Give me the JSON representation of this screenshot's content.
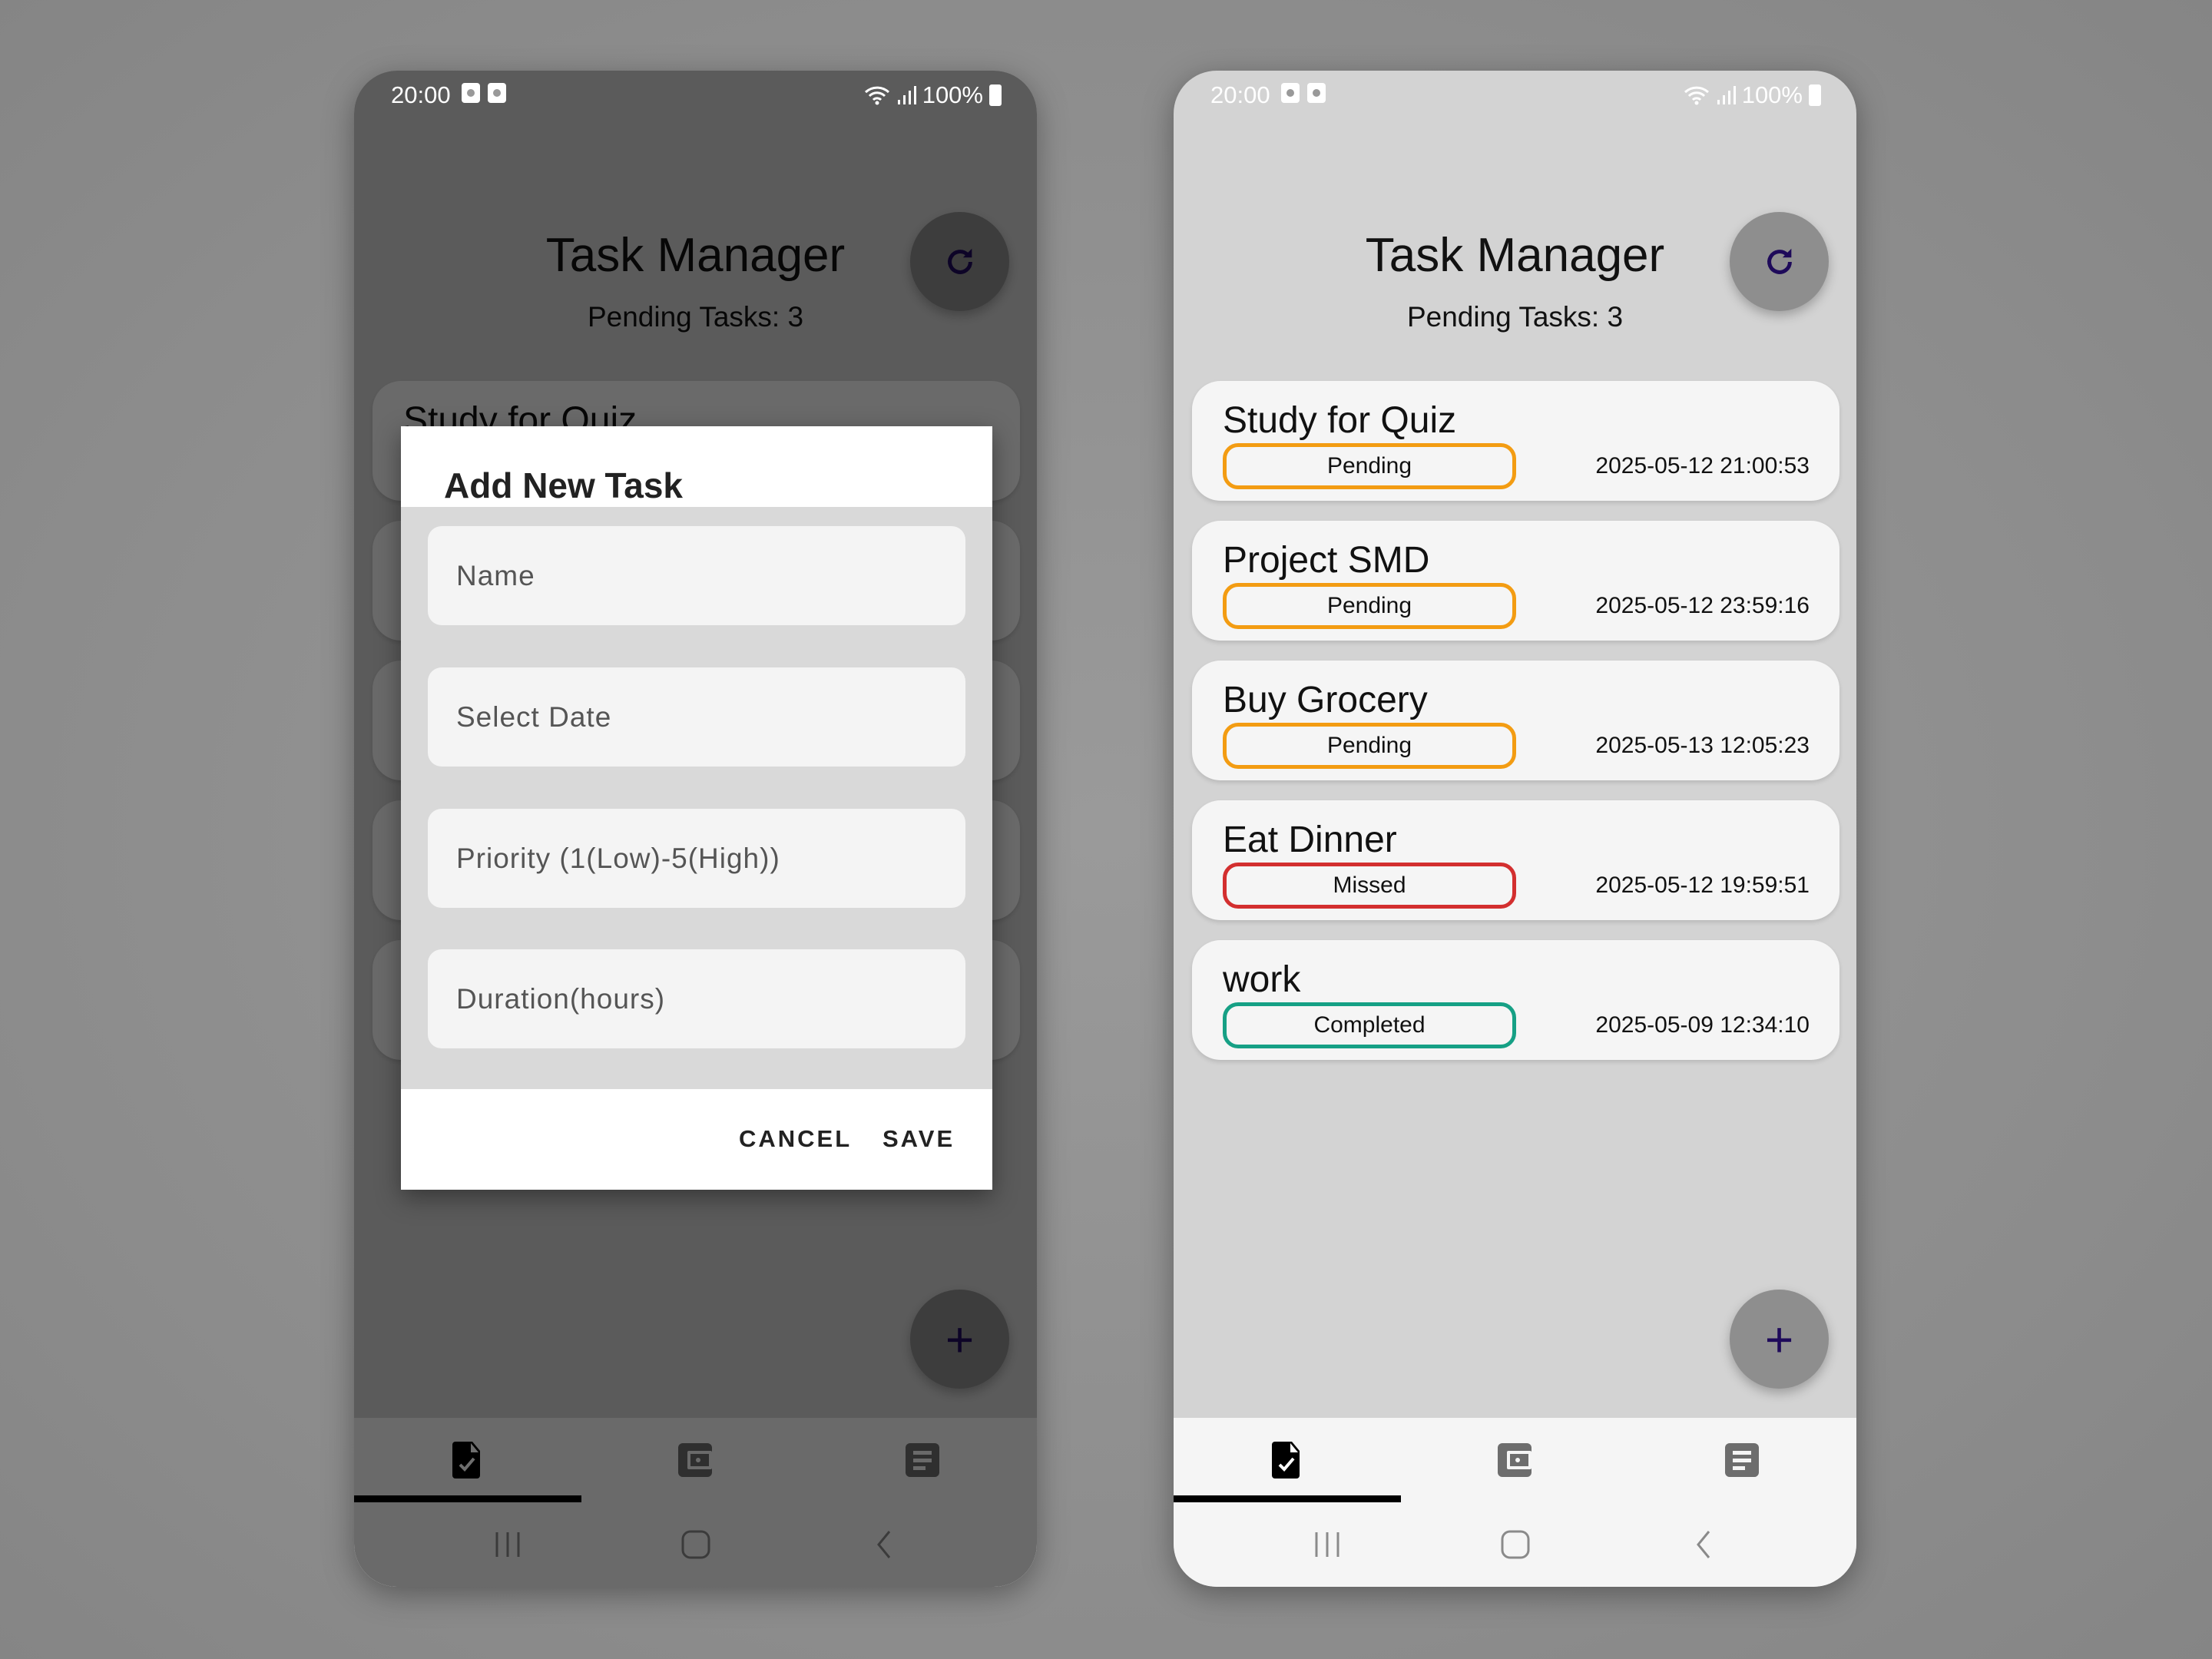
{
  "status_bar": {
    "time": "20:00",
    "battery": "100%"
  },
  "header": {
    "title": "Task Manager",
    "pending": "Pending Tasks: 3",
    "refresh_icon": "refresh-icon"
  },
  "tasks": [
    {
      "name": "Study for Quiz",
      "status": "Pending",
      "date": "2025-05-12 21:00:53"
    },
    {
      "name": "Project SMD",
      "status": "Pending",
      "date": "2025-05-12 23:59:16"
    },
    {
      "name": "Buy Grocery",
      "status": "Pending",
      "date": "2025-05-13 12:05:23"
    },
    {
      "name": "Eat Dinner",
      "status": "Missed",
      "date": "2025-05-12 19:59:51"
    },
    {
      "name": "work",
      "status": "Completed",
      "date": "2025-05-09 12:34:10"
    }
  ],
  "status_colors": {
    "Pending": "#f39c12",
    "Missed": "#d32f2f",
    "Completed": "#16a085"
  },
  "fab": {
    "label": "+"
  },
  "bottom_nav": {
    "tabs": [
      "task-check-icon",
      "wallet-icon",
      "list-icon"
    ],
    "active": 0
  },
  "dialog": {
    "title": "Add New Task",
    "fields": [
      {
        "placeholder": "Name"
      },
      {
        "placeholder": "Select Date"
      },
      {
        "placeholder": "Priority (1(Low)-5(High))"
      },
      {
        "placeholder": "Duration(hours)"
      }
    ],
    "cancel": "CANCEL",
    "save": "SAVE"
  }
}
